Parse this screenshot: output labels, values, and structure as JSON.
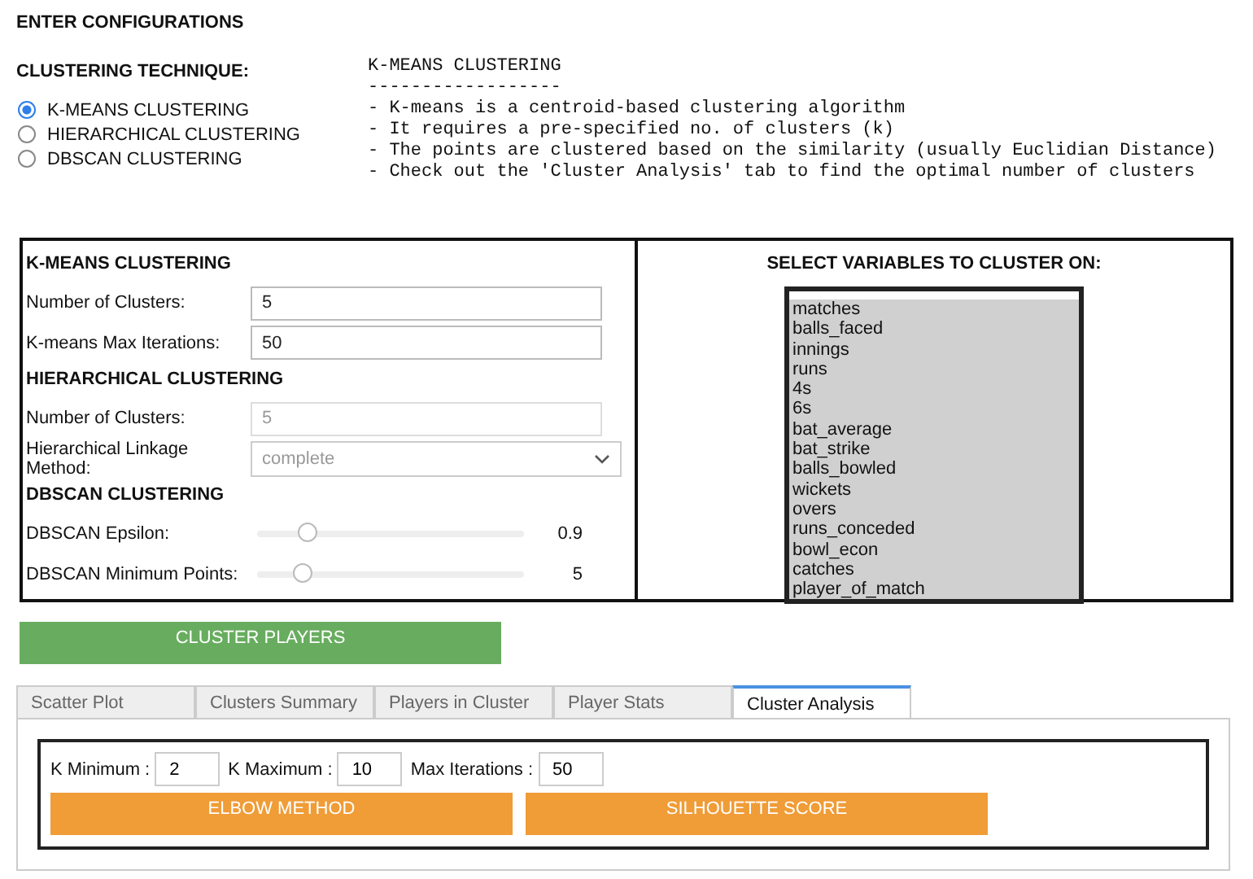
{
  "heading": "ENTER CONFIGURATIONS",
  "technique": {
    "label": "CLUSTERING TECHNIQUE:",
    "options": [
      {
        "label": "K-MEANS CLUSTERING",
        "selected": true
      },
      {
        "label": "HIERARCHICAL CLUSTERING",
        "selected": false
      },
      {
        "label": "DBSCAN CLUSTERING",
        "selected": false
      }
    ]
  },
  "description": [
    "K-MEANS CLUSTERING",
    "------------------",
    "- K-means is a centroid-based clustering algorithm",
    "- It requires a pre-specified no. of clusters (k)",
    "- The points are clustered based on the similarity (usually Euclidian Distance)",
    "- Check out the 'Cluster Analysis' tab to find the optimal number of clusters"
  ],
  "settings": [
    {
      "kind": "heading",
      "label": "K-MEANS CLUSTERING"
    },
    {
      "kind": "input",
      "label": "Number of Clusters:",
      "value": "5",
      "disabled": false
    },
    {
      "kind": "input",
      "label": "K-means Max Iterations:",
      "value": "50",
      "disabled": false
    },
    {
      "kind": "heading",
      "label": "HIERARCHICAL CLUSTERING"
    },
    {
      "kind": "input",
      "label": "Number of Clusters:",
      "value": "5",
      "disabled": true
    },
    {
      "kind": "select",
      "label": "Hierarchical Linkage Method:",
      "value": "complete",
      "disabled": true
    },
    {
      "kind": "heading",
      "label": "DBSCAN CLUSTERING"
    },
    {
      "kind": "slider",
      "label": "DBSCAN Epsilon:",
      "level": 0.19,
      "reading": "0.9"
    },
    {
      "kind": "slider",
      "label": "DBSCAN Minimum Points:",
      "level": 0.17,
      "reading": "5"
    }
  ],
  "variables": {
    "title": "SELECT VARIABLES TO CLUSTER ON:",
    "items": [
      {
        "label": "matches",
        "selected": true
      },
      {
        "label": "balls_faced",
        "selected": true
      },
      {
        "label": "innings",
        "selected": true
      },
      {
        "label": "runs",
        "selected": true
      },
      {
        "label": "4s",
        "selected": true
      },
      {
        "label": "6s",
        "selected": true
      },
      {
        "label": "bat_average",
        "selected": true
      },
      {
        "label": "bat_strike",
        "selected": true
      },
      {
        "label": "balls_bowled",
        "selected": true
      },
      {
        "label": "wickets",
        "selected": true
      },
      {
        "label": "overs",
        "selected": true
      },
      {
        "label": "runs_conceded",
        "selected": true
      },
      {
        "label": "bowl_econ",
        "selected": true
      },
      {
        "label": "catches",
        "selected": true
      },
      {
        "label": "player_of_match",
        "selected": true
      }
    ]
  },
  "cluster_button": "CLUSTER PLAYERS",
  "tabs": [
    {
      "label": "Scatter Plot",
      "selected": false
    },
    {
      "label": "Clusters Summary",
      "selected": false
    },
    {
      "label": "Players in Cluster",
      "selected": false
    },
    {
      "label": "Player Stats",
      "selected": false
    },
    {
      "label": "Cluster Analysis",
      "selected": true
    }
  ],
  "analysis": {
    "fields": [
      {
        "label": "K Minimum :",
        "value": "2"
      },
      {
        "label": "K Maximum :",
        "value": "10"
      },
      {
        "label": "Max Iterations :",
        "value": "50"
      }
    ],
    "buttons": [
      "ELBOW METHOD",
      "SILHOUETTE SCORE"
    ]
  }
}
